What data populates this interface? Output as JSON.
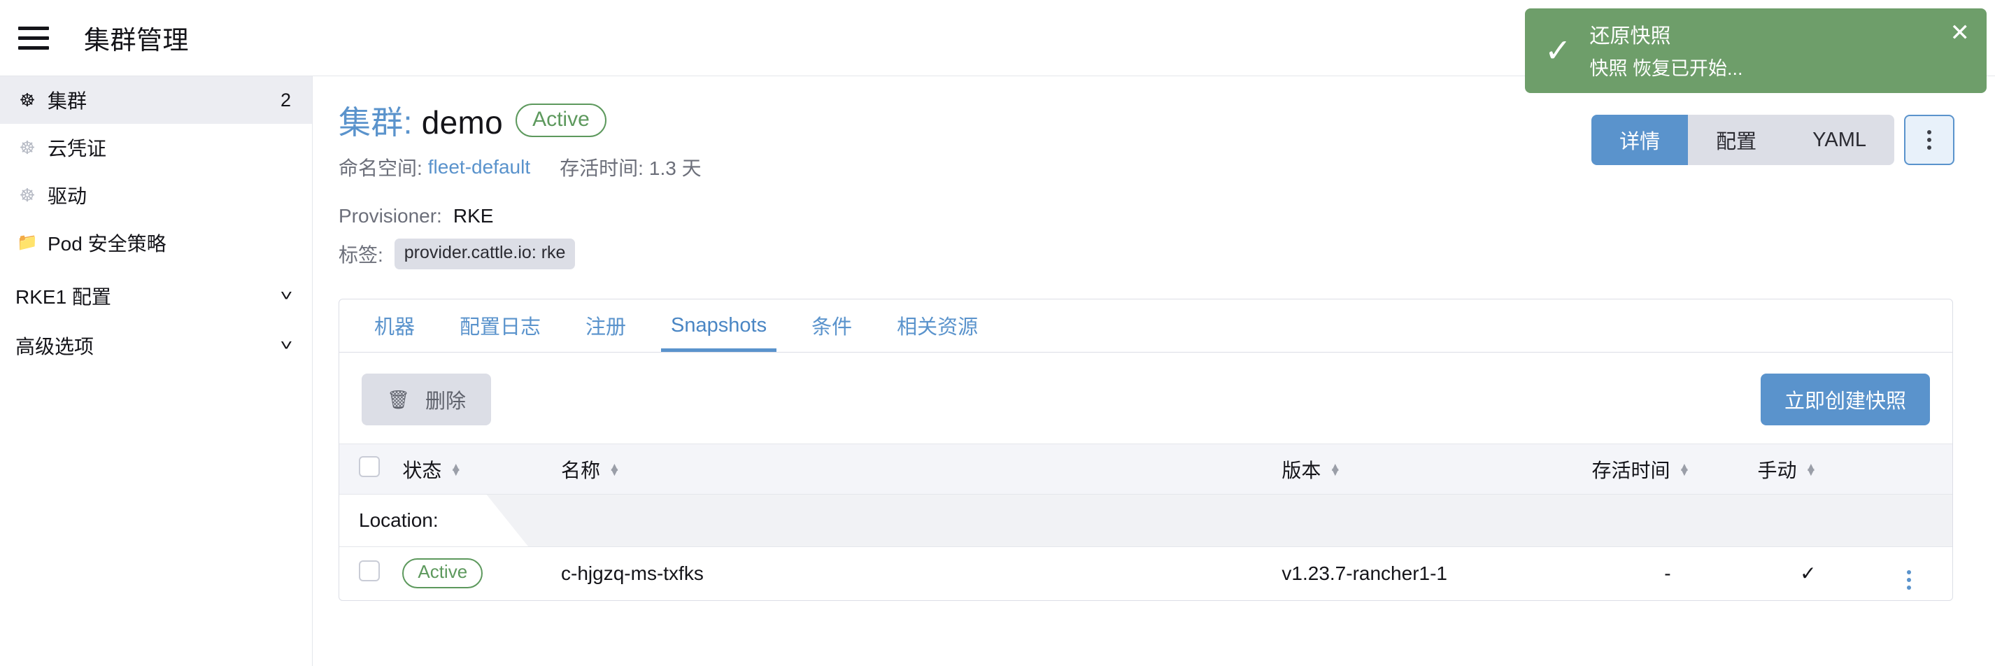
{
  "header": {
    "menu_icon": "hamburger-icon",
    "title": "集群管理"
  },
  "sidebar": {
    "items": [
      {
        "label": "集群",
        "icon": "globe-icon",
        "count": "2",
        "active": true
      },
      {
        "label": "云凭证",
        "icon": "globe-icon",
        "count": "",
        "active": false
      },
      {
        "label": "驱动",
        "icon": "globe-icon",
        "count": "",
        "active": false
      },
      {
        "label": "Pod 安全策略",
        "icon": "folder-icon",
        "count": "",
        "active": false
      }
    ],
    "groups": [
      {
        "label": "RKE1 配置",
        "chevron": "chevron-down-icon"
      },
      {
        "label": "高级选项",
        "chevron": "chevron-down-icon"
      }
    ]
  },
  "page": {
    "title_prefix": "集群:",
    "title_name": "demo",
    "status_badge": "Active",
    "namespace_label": "命名空间:",
    "namespace_value": "fleet-default",
    "age_label": "存活时间:",
    "age_value": "1.3 天",
    "provisioner_label": "Provisioner:",
    "provisioner_value": "RKE",
    "labels_label": "标签:",
    "label_chip": "provider.cattle.io: rke"
  },
  "actions": {
    "segments": [
      {
        "label": "详情",
        "selected": true
      },
      {
        "label": "配置",
        "selected": false
      },
      {
        "label": "YAML",
        "selected": false
      }
    ],
    "kebab": "kebab-menu-icon"
  },
  "tabs": [
    {
      "label": "机器",
      "selected": false
    },
    {
      "label": "配置日志",
      "selected": false
    },
    {
      "label": "注册",
      "selected": false
    },
    {
      "label": "Snapshots",
      "selected": true
    },
    {
      "label": "条件",
      "selected": false
    },
    {
      "label": "相关资源",
      "selected": false
    }
  ],
  "toolbar": {
    "delete_label": "删除",
    "delete_icon": "trash-icon",
    "create_label": "立即创建快照"
  },
  "table": {
    "columns": [
      {
        "key": "state",
        "label": "状态",
        "sortable": true
      },
      {
        "key": "name",
        "label": "名称",
        "sortable": true
      },
      {
        "key": "version",
        "label": "版本",
        "sortable": true
      },
      {
        "key": "age",
        "label": "存活时间",
        "sortable": true
      },
      {
        "key": "manual",
        "label": "手动",
        "sortable": true
      }
    ],
    "group_label": "Location:",
    "rows": [
      {
        "state": "Active",
        "name": "c-hjgzq-ms-txfks",
        "version": "v1.23.7-rancher1-1",
        "age": "-",
        "manual": "✓"
      }
    ]
  },
  "toast": {
    "icon": "check-icon",
    "title": "还原快照",
    "message": "快照 恢复已开始...",
    "close_icon": "close-icon",
    "color": "#6e9e6a"
  },
  "colors": {
    "accent": "#5a93cc",
    "success": "#5d995d",
    "muted": "#6c6f7a"
  }
}
